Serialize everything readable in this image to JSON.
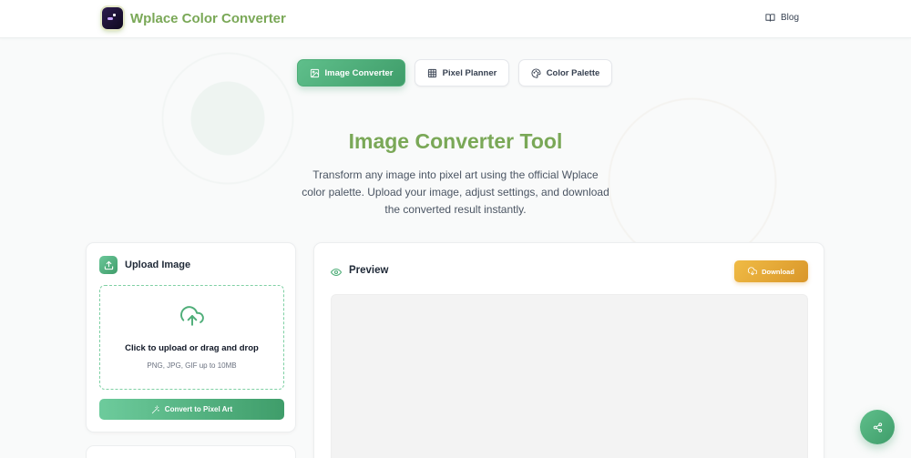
{
  "header": {
    "brand": "Wplace Color Converter",
    "blog_label": "Blog"
  },
  "tabs": [
    {
      "label": "Image Converter",
      "icon": "image-icon",
      "active": true
    },
    {
      "label": "Pixel Planner",
      "icon": "grid-icon",
      "active": false
    },
    {
      "label": "Color Palette",
      "icon": "palette-icon",
      "active": false
    }
  ],
  "hero": {
    "title": "Image Converter Tool",
    "description": "Transform any image into pixel art using the official Wplace color palette. Upload your image, adjust settings, and download the converted result instantly."
  },
  "upload": {
    "title": "Upload Image",
    "dropzone_title": "Click to upload or drag and drop",
    "dropzone_sub": "PNG, JPG, GIF up to 10MB",
    "convert_label": "Convert to Pixel Art"
  },
  "preview": {
    "title": "Preview",
    "download_label": "Download"
  },
  "colors": {
    "accent_green": "#3f9d6a",
    "brand_text": "#7aa857",
    "download_gold": "#e0a535"
  }
}
